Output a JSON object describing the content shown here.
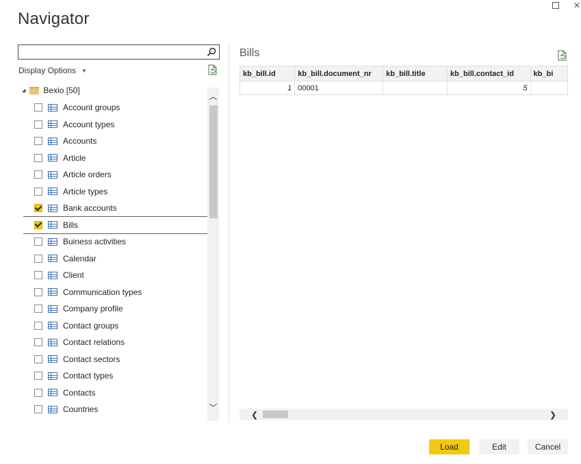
{
  "window": {
    "title": "Navigator",
    "maximize_glyph": "",
    "close_glyph": "✕"
  },
  "search": {
    "value": "",
    "placeholder": "",
    "icon": "search-icon"
  },
  "display_options": {
    "label": "Display Options",
    "caret": "▼"
  },
  "tree": {
    "root_label": "Bexio [50]",
    "items": [
      {
        "label": "Account groups",
        "checked": false
      },
      {
        "label": "Account types",
        "checked": false
      },
      {
        "label": "Accounts",
        "checked": false
      },
      {
        "label": "Article",
        "checked": false
      },
      {
        "label": "Article orders",
        "checked": false
      },
      {
        "label": "Article types",
        "checked": false
      },
      {
        "label": "Bank accounts",
        "checked": true
      },
      {
        "label": "Bills",
        "checked": true,
        "selected": true
      },
      {
        "label": "Buiness activities",
        "checked": false
      },
      {
        "label": "Calendar",
        "checked": false
      },
      {
        "label": "Client",
        "checked": false
      },
      {
        "label": "Communication types",
        "checked": false
      },
      {
        "label": "Company profile",
        "checked": false
      },
      {
        "label": "Contact groups",
        "checked": false
      },
      {
        "label": "Contact relations",
        "checked": false
      },
      {
        "label": "Contact sectors",
        "checked": false
      },
      {
        "label": "Contact types",
        "checked": false
      },
      {
        "label": "Contacts",
        "checked": false
      },
      {
        "label": "Countries",
        "checked": false
      }
    ]
  },
  "preview": {
    "title": "Bills",
    "columns": [
      "kb_bill.id",
      "kb_bill.document_nr",
      "kb_bill.title",
      "kb_bill.contact_id",
      "kb_bi"
    ],
    "rows": [
      [
        "1",
        "00001",
        "",
        "5",
        ""
      ]
    ]
  },
  "scroll_glyphs": {
    "up": "︿",
    "down": "﹀",
    "left": "❮",
    "right": "❯"
  },
  "buttons": {
    "load": "Load",
    "edit": "Edit",
    "cancel": "Cancel"
  },
  "colors": {
    "accent": "#f2c811",
    "secondary_button": "#f3f2f1"
  }
}
